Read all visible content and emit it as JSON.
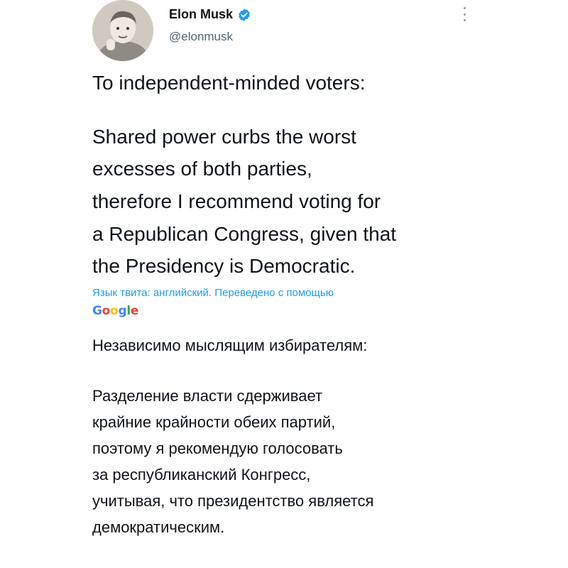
{
  "author": {
    "name": "Elon Musk",
    "handle": "@elonmusk",
    "verified": true,
    "avatar_icon": "child-portrait-avatar",
    "verified_color": "#1d9bf0"
  },
  "menu": {
    "icon": "more-vertical-icon"
  },
  "original_text": {
    "lines": [
      "To independent-minded voters:",
      "Shared power curbs the worst",
      "excesses of both parties,",
      "therefore I recommend voting for",
      "a Republican Congress, given that",
      "the Presidency is Democratic."
    ]
  },
  "translation": {
    "note": "Язык твита: английский. Переведено с помощью",
    "provider_letters": [
      "G",
      "o",
      "o",
      "g",
      "l",
      "e"
    ],
    "provider_colors": [
      "#4285f4",
      "#ea4335",
      "#fbbc05",
      "#4285f4",
      "#34a853",
      "#ea4335"
    ],
    "lines": [
      "Независимо мыслящим избирателям:",
      "Разделение власти сдерживает",
      "крайние крайности обеих партий,",
      "поэтому я рекомендую голосовать",
      "за республиканский Конгресс,",
      "учитывая, что президентство является",
      "демократическим."
    ]
  }
}
